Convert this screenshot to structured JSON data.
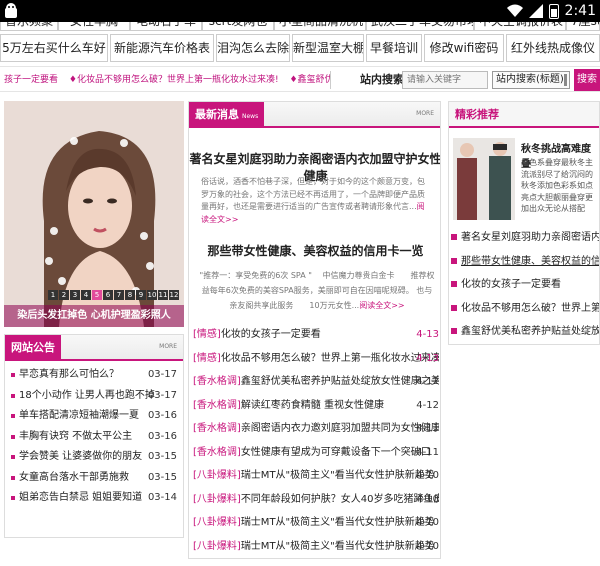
{
  "status_bar": {
    "time": "2:41"
  },
  "keywords_row0": [
    "音乐频聚",
    "女性丰胸",
    "电动名手车",
    "scrt发网也",
    "小型商品清洗机",
    "武汉二手车交易市场",
    "中央空调报价表",
    "7座suv7车人生"
  ],
  "keywords_row1": [
    "5万左右买什么车好",
    "新能源汽车价格表",
    "泪沟怎么去除",
    "新型温室大棚",
    "早餐培训",
    "修改wifi密码",
    "红外线热成像仪"
  ],
  "ticker": {
    "links": [
      "孩子一定要看",
      "♦化妆品不够用怎么破？世界上第一瓶化妆水过来凑!",
      "♦鑫玺舒优美私密养护贴益处绽放"
    ],
    "search_label": "站内搜索",
    "search_placeholder": "请输入关键字",
    "search_select": "站内搜索(标题)",
    "search_button": "搜索"
  },
  "slide": {
    "pages": [
      "1",
      "2",
      "3",
      "4",
      "5",
      "6",
      "7",
      "8",
      "9",
      "10",
      "11",
      "12"
    ],
    "active_page": "5",
    "caption": "染后头发扛掉色 心机护理盈彩照人"
  },
  "notice": {
    "title": "网站公告",
    "more": "MORE",
    "items": [
      {
        "text": "早恋真有那么可怕么？",
        "date": "03-17"
      },
      {
        "text": "18个小动作 让男人再也跑不掉",
        "date": "03-17"
      },
      {
        "text": "单车搭配清凉短袖潮爆一夏",
        "date": "03-16"
      },
      {
        "text": "丰胸有诀窍 不做太平公主",
        "date": "03-16"
      },
      {
        "text": "学会赞美 让婆婆做你的朋友",
        "date": "03-15"
      },
      {
        "text": "女童高台落水干部勇施救",
        "date": "03-15"
      },
      {
        "text": "姐弟恋告白禁忌 姐姐要知道",
        "date": "03-14"
      }
    ]
  },
  "news": {
    "title": "最新消息",
    "subtitle": "News",
    "more": "MORE",
    "headline1": "著名女星刘庭羽助力亲阁密语内衣加盟守护女性健康",
    "summary1": "俗话说，酒香不怕巷子深，但是，对于如今的这个颇意万变，包罗万象的社会，这个方法已经不再适用了，一个品牌即便产品质量再好，也还是需要进行适当的广告宣传或者聘请形象代言...",
    "read_more1": "阅读全文>>",
    "headline2": "那些带女性健康、美容权益的信用卡一览",
    "summary2": "\"推荐一：享受免费的6次 SPA \"　 中信魔力尊贵白金卡　　推荐权益每年6次免费的美容SPA服务，美丽即可自在因喵呢规碍。 也与亲友阁共享此服务　　10万元女性...",
    "read_more2": "阅读全文>>",
    "items": [
      {
        "category": "[情感]",
        "text": "化妆的女孩子一定要看",
        "date": "4-13",
        "pink": true
      },
      {
        "category": "[情感]",
        "text": "化妆品不够用怎么破？世界上第一瓶化妆水过来凑!",
        "date": "4-13",
        "pink": true
      },
      {
        "category": "[香水格调]",
        "text": "鑫玺舒优美私密养护贴益处绽放女性健康之美",
        "date": "4-12",
        "pink": false
      },
      {
        "category": "[香水格调]",
        "text": "解读红枣药食精髓 重视女性健康",
        "date": "4-12",
        "pink": false
      },
      {
        "category": "[香水格调]",
        "text": "亲阁密语内衣力邀刘庭羽加盟共同为女性健康护",
        "date": "4-11",
        "pink": false
      },
      {
        "category": "[香水格调]",
        "text": "女性健康有望成为可穿戴设备下一个突破口",
        "date": "4-11",
        "pink": false
      },
      {
        "category": "[八卦爆料]",
        "text": "瑞士MT从\"极简主义\"看当代女性护肤新趋势",
        "date": "4-10",
        "pink": false
      },
      {
        "category": "[八卦爆料]",
        "text": "不同年龄段如何护肤？女人40岁多吃猪蹄鱼皮",
        "date": "4-10",
        "pink": false
      },
      {
        "category": "[八卦爆料]",
        "text": "瑞士MT从\"极简主义\"看当代女性护肤新趋势",
        "date": "4-10",
        "pink": false
      },
      {
        "category": "[八卦爆料]",
        "text": "瑞士MT从\"极简主义\"看当代女性护肤新趋势",
        "date": "4-10",
        "pink": false
      }
    ]
  },
  "featured": {
    "title": "精彩推荐",
    "lead_title": "秋冬挑战高难度叠",
    "lead_desc": "黑色系叠穿最秋冬主流派别尽了给沉闷的秋冬添加色彩系如点亮点大胆靓丽叠穿更加出众无论从搭配",
    "items": [
      {
        "text": "著名女星刘庭羽助力亲阁密语内衣",
        "underline": false
      },
      {
        "text": "那些带女性健康、美容权益的信用卡",
        "underline": true
      },
      {
        "text": "化妆的女孩子一定要看",
        "underline": false
      },
      {
        "text": "化妆品不够用怎么破？世界上第一",
        "underline": false
      },
      {
        "text": "鑫玺舒优美私密养护贴益处绽放女",
        "underline": false
      }
    ]
  },
  "colors": {
    "accent": "#c8157c",
    "status_bar": "#000000"
  },
  "icons": [
    "android-icon",
    "wifi-icon",
    "signal-icon",
    "battery-icon"
  ]
}
